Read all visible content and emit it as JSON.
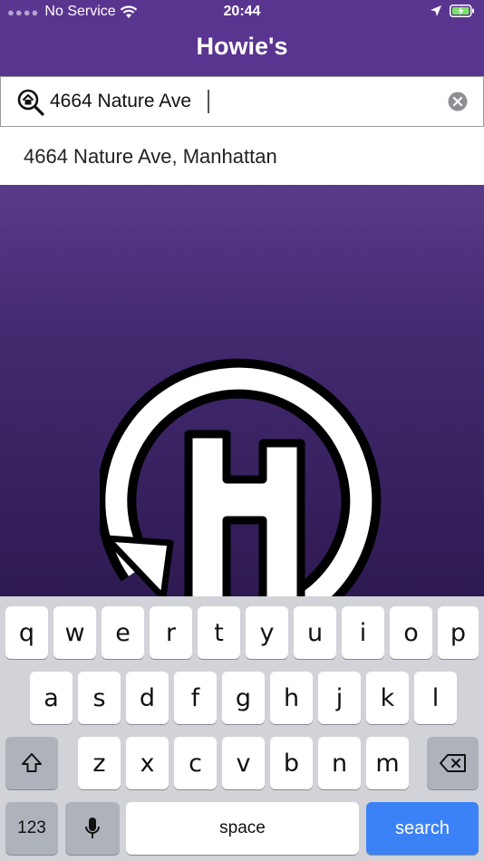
{
  "status_bar": {
    "carrier": "No Service",
    "time": "20:44"
  },
  "nav": {
    "title": "Howie's"
  },
  "search": {
    "value": "4664 Nature Ave"
  },
  "suggestions": [
    {
      "text": "4664 Nature Ave, Manhattan"
    }
  ],
  "keyboard": {
    "row1": [
      "q",
      "w",
      "e",
      "r",
      "t",
      "y",
      "u",
      "i",
      "o",
      "p"
    ],
    "row2": [
      "a",
      "s",
      "d",
      "f",
      "g",
      "h",
      "j",
      "k",
      "l"
    ],
    "row3": [
      "z",
      "x",
      "c",
      "v",
      "b",
      "n",
      "m"
    ],
    "numbers_label": "123",
    "space_label": "space",
    "search_label": "search"
  },
  "colors": {
    "brand_purple": "#5a3590",
    "accent_blue": "#3b82f6"
  }
}
